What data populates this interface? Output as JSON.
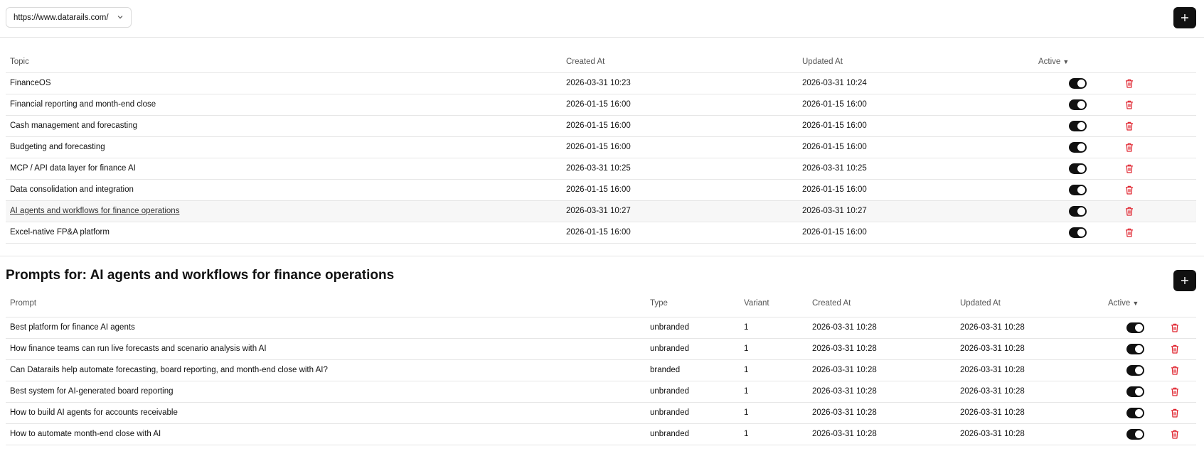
{
  "header": {
    "url_value": "https://www.datarails.com/",
    "add_label": "+"
  },
  "topics": {
    "columns": {
      "topic": "Topic",
      "created": "Created At",
      "updated": "Updated At",
      "active": "Active",
      "sort_arrow": "▼"
    },
    "rows": [
      {
        "topic": "FinanceOS",
        "created": "2026-03-31 10:23",
        "updated": "2026-03-31 10:24",
        "active": true
      },
      {
        "topic": "Financial reporting and month-end close",
        "created": "2026-01-15 16:00",
        "updated": "2026-01-15 16:00",
        "active": true
      },
      {
        "topic": "Cash management and forecasting",
        "created": "2026-01-15 16:00",
        "updated": "2026-01-15 16:00",
        "active": true
      },
      {
        "topic": "Budgeting and forecasting",
        "created": "2026-01-15 16:00",
        "updated": "2026-01-15 16:00",
        "active": true
      },
      {
        "topic": "MCP / API data layer for finance AI",
        "created": "2026-03-31 10:25",
        "updated": "2026-03-31 10:25",
        "active": true
      },
      {
        "topic": "Data consolidation and integration",
        "created": "2026-01-15 16:00",
        "updated": "2026-01-15 16:00",
        "active": true
      },
      {
        "topic": "AI agents and workflows for finance operations",
        "created": "2026-03-31 10:27",
        "updated": "2026-03-31 10:27",
        "active": true
      },
      {
        "topic": "Excel-native FP&A platform",
        "created": "2026-01-15 16:00",
        "updated": "2026-01-15 16:00",
        "active": true
      }
    ]
  },
  "prompts": {
    "title": "Prompts for: AI agents and workflows for finance operations",
    "add_label": "+",
    "columns": {
      "prompt": "Prompt",
      "type": "Type",
      "variant": "Variant",
      "created": "Created At",
      "updated": "Updated At",
      "active": "Active",
      "sort_arrow": "▼"
    },
    "rows": [
      {
        "prompt": "Best platform for finance AI agents",
        "type": "unbranded",
        "variant": "1",
        "created": "2026-03-31 10:28",
        "updated": "2026-03-31 10:28",
        "active": true
      },
      {
        "prompt": "How finance teams can run live forecasts and scenario analysis with AI",
        "type": "unbranded",
        "variant": "1",
        "created": "2026-03-31 10:28",
        "updated": "2026-03-31 10:28",
        "active": true
      },
      {
        "prompt": "Can Datarails help automate forecasting, board reporting, and month-end close with AI?",
        "type": "branded",
        "variant": "1",
        "created": "2026-03-31 10:28",
        "updated": "2026-03-31 10:28",
        "active": true
      },
      {
        "prompt": "Best system for AI-generated board reporting",
        "type": "unbranded",
        "variant": "1",
        "created": "2026-03-31 10:28",
        "updated": "2026-03-31 10:28",
        "active": true
      },
      {
        "prompt": "How to build AI agents for accounts receivable",
        "type": "unbranded",
        "variant": "1",
        "created": "2026-03-31 10:28",
        "updated": "2026-03-31 10:28",
        "active": true
      },
      {
        "prompt": "How to automate month-end close with AI",
        "type": "unbranded",
        "variant": "1",
        "created": "2026-03-31 10:28",
        "updated": "2026-03-31 10:28",
        "active": true
      }
    ]
  },
  "icons": {
    "delete": "trash-icon",
    "add": "plus-icon",
    "dropdown": "chevron-down-icon"
  },
  "colors": {
    "toggle_on": "#111111",
    "delete": "#e0242f",
    "primary_button": "#111111"
  }
}
